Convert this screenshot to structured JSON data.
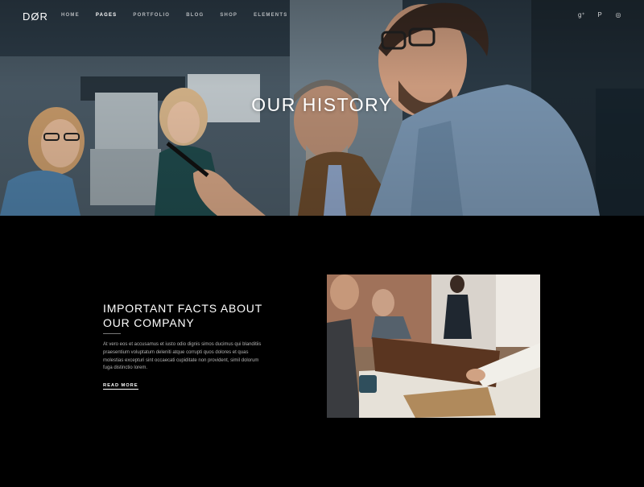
{
  "brand": {
    "logo": "DØR"
  },
  "nav": {
    "items": [
      {
        "label": "HOME"
      },
      {
        "label": "PAGES"
      },
      {
        "label": "PORTFOLIO"
      },
      {
        "label": "BLOG"
      },
      {
        "label": "SHOP"
      },
      {
        "label": "ELEMENTS"
      }
    ],
    "active": "PAGES"
  },
  "social": [
    {
      "icon": "google-plus-icon",
      "glyph": "g⁺"
    },
    {
      "icon": "pinterest-icon",
      "glyph": "P"
    },
    {
      "icon": "dribbble-icon",
      "glyph": "◎"
    }
  ],
  "hero": {
    "title": "OUR HISTORY"
  },
  "facts": {
    "title_line1": "IMPORTANT FACTS ABOUT",
    "title_line2": "OUR COMPANY",
    "body": "At vero eos et accusamus et iusto odio dignis simos ducimus qui blanditiis praesentium voluptatum deleniti atque corrupti quos dolores et quas molestias excepturi sint occaecati cupiditate non provident, simil dolorum fuga distinctio lorem.",
    "read_more": "READ MORE"
  }
}
